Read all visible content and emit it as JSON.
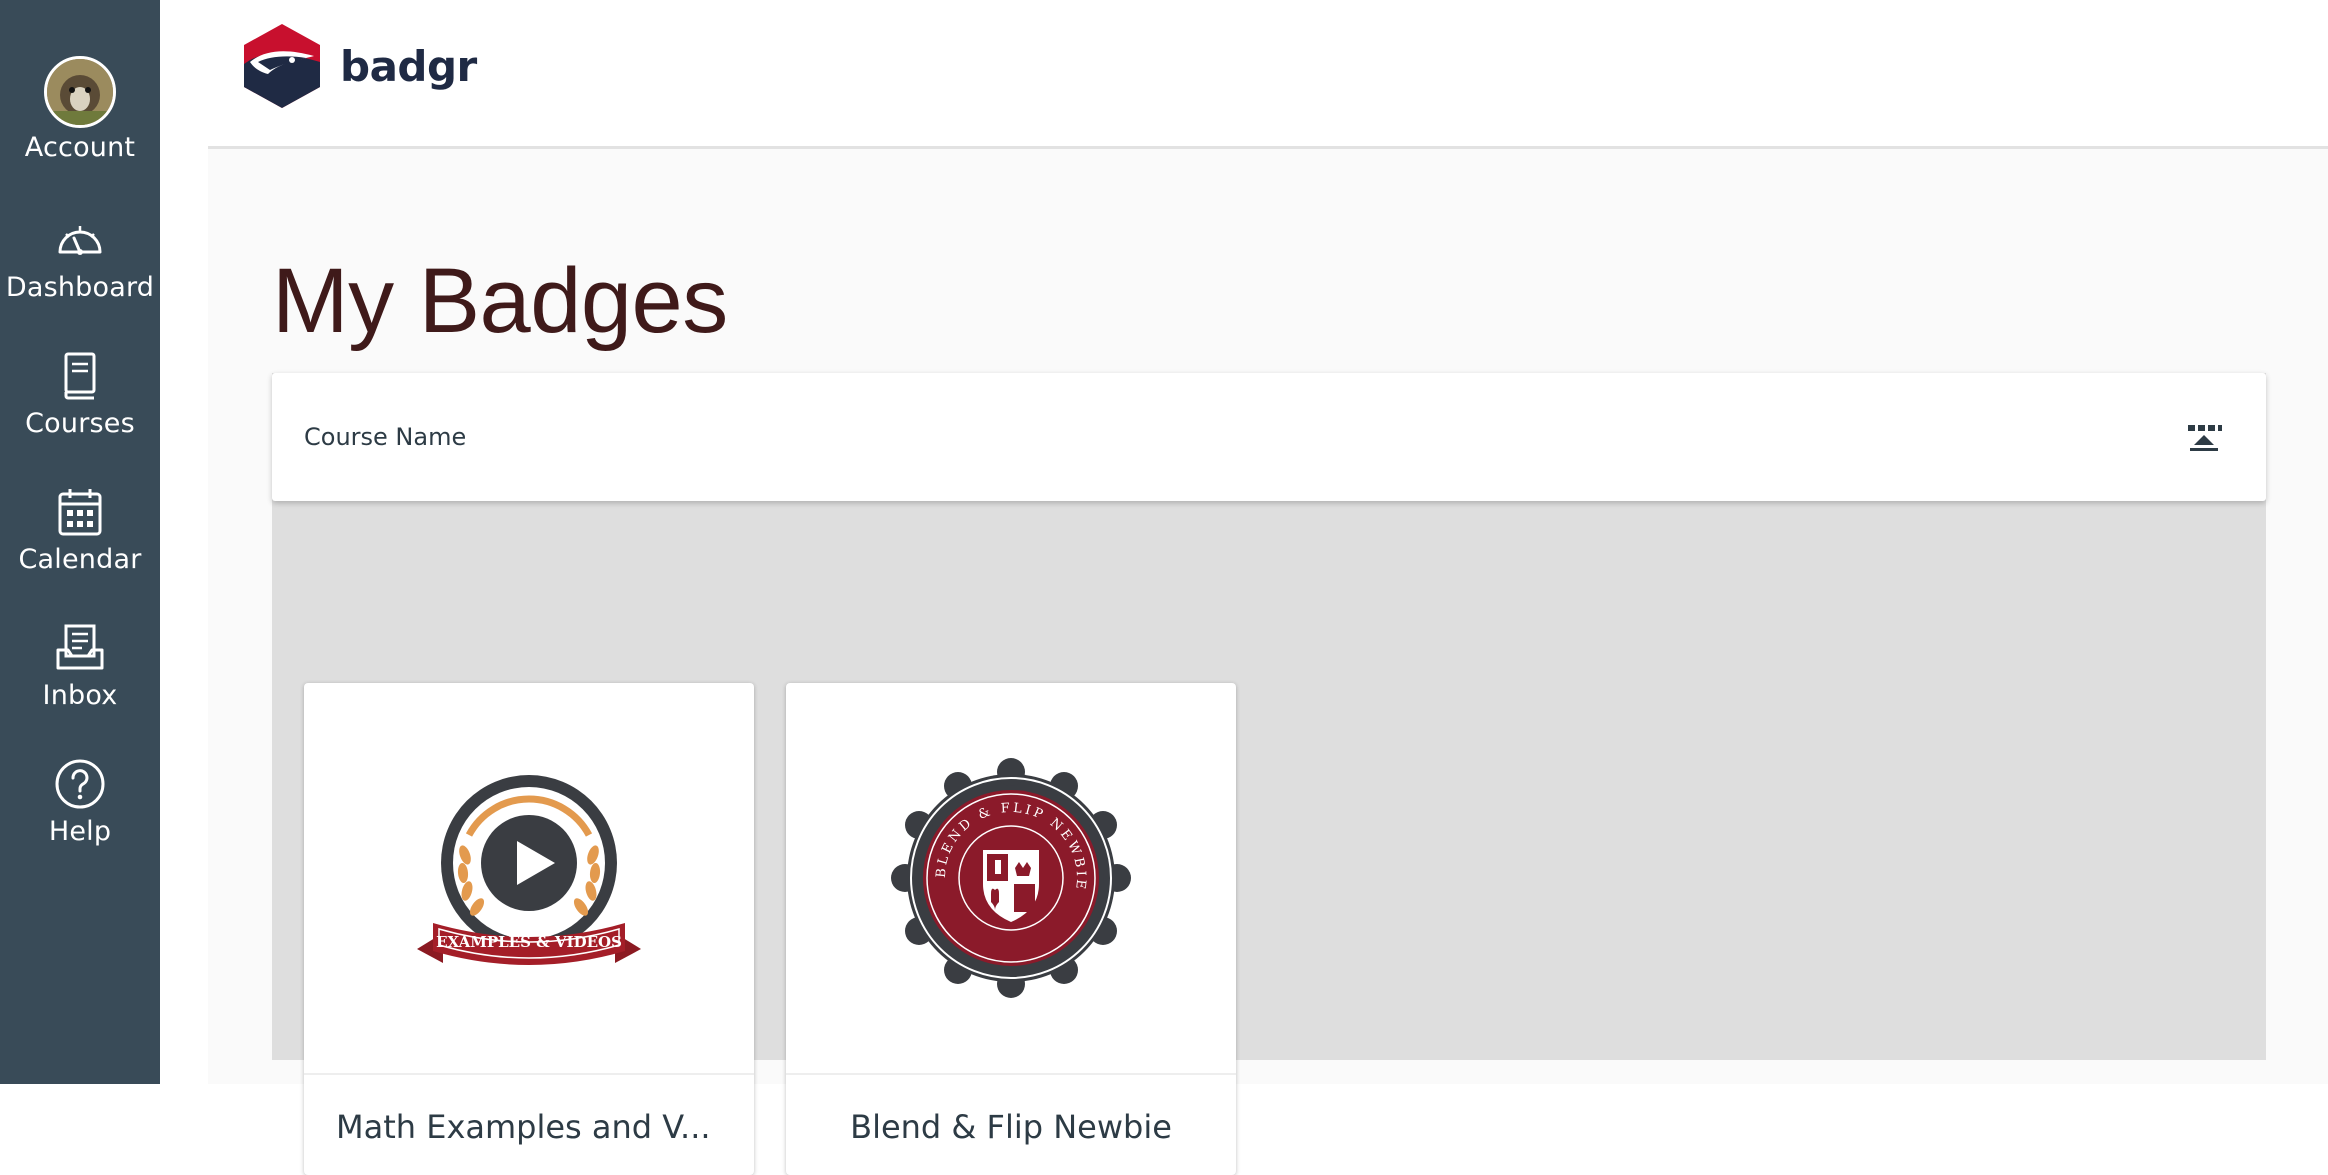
{
  "nav": {
    "items": [
      {
        "id": "account",
        "label": "Account",
        "icon": "avatar"
      },
      {
        "id": "dashboard",
        "label": "Dashboard",
        "icon": "dashboard-gauge-icon"
      },
      {
        "id": "courses",
        "label": "Courses",
        "icon": "book-icon"
      },
      {
        "id": "calendar",
        "label": "Calendar",
        "icon": "calendar-icon"
      },
      {
        "id": "inbox",
        "label": "Inbox",
        "icon": "inbox-icon"
      },
      {
        "id": "help",
        "label": "Help",
        "icon": "help-question-icon"
      }
    ],
    "background": "#394b58"
  },
  "header": {
    "logo_text": "badgr",
    "logo_colors": {
      "red": "#c8102e",
      "navy": "#1f2a44"
    }
  },
  "main": {
    "title": "My Badges",
    "panel": {
      "heading": "Course Name",
      "layout_toggle_icon": "layout-toggle-icon"
    },
    "badges": [
      {
        "title": "Math Examples and V...",
        "image": "examples-videos-badge",
        "ribbon_text": "EXAMPLES & VIDEOS"
      },
      {
        "title": "Blend & Flip Newbie",
        "image": "blend-flip-newbie-seal",
        "ring_text": "BLEND & FLIP NEWBIE"
      }
    ]
  }
}
